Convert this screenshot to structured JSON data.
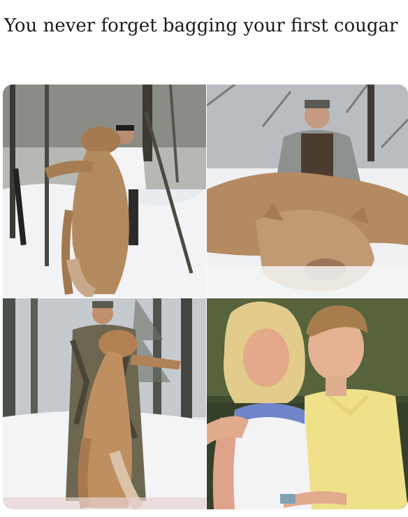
{
  "caption": "You never forget bagging your first cougar",
  "panels": [
    {
      "subject": "hunter-holding-cougar-snowy-forest"
    },
    {
      "subject": "hunter-kneeling-behind-cougar"
    },
    {
      "subject": "hunter-holding-cougar-winter-woods"
    },
    {
      "subject": "older-woman-with-young-man"
    }
  ]
}
